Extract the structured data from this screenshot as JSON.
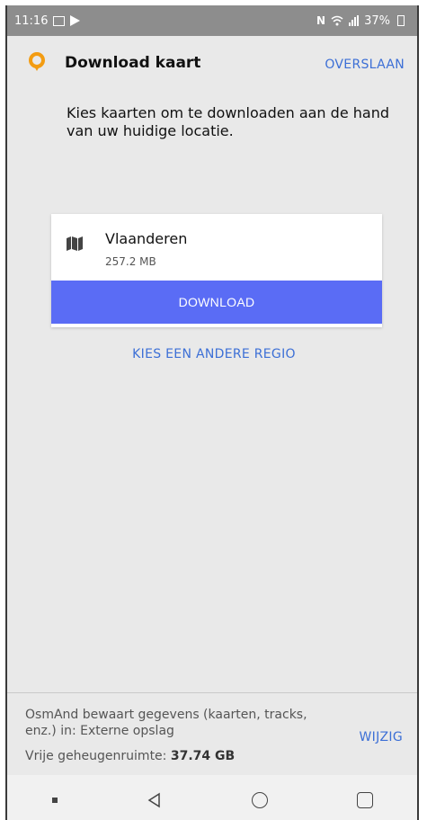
{
  "status_bar": {
    "time": "11:16",
    "battery": "37%"
  },
  "header": {
    "title": "Download kaart",
    "skip_label": "OVERSLAAN"
  },
  "description": "Kies kaarten om te downloaden aan de hand van uw huidige locatie.",
  "region": {
    "name": "Vlaanderen",
    "size": "257.2 MB",
    "download_label": "DOWNLOAD"
  },
  "other_region_label": "KIES EEN ANDERE REGIO",
  "footer": {
    "storage_info": "OsmAnd bewaart gegevens (kaarten, tracks, enz.) in: Externe opslag",
    "change_label": "WIJZIG",
    "free_space_label": "Vrije geheugenruimte:",
    "free_space_value": "37.74 GB"
  },
  "icons": {
    "logo": "osmand-pin-icon",
    "map": "map-icon",
    "nav_back": "back-triangle-icon",
    "nav_home": "home-circle-icon",
    "nav_recent": "recent-square-icon"
  },
  "colors": {
    "accent": "#3c6fd6",
    "button": "#5a6cf5",
    "logo": "#f39c12",
    "status_bar": "#8d8d8d",
    "background": "#e9e9e9"
  }
}
